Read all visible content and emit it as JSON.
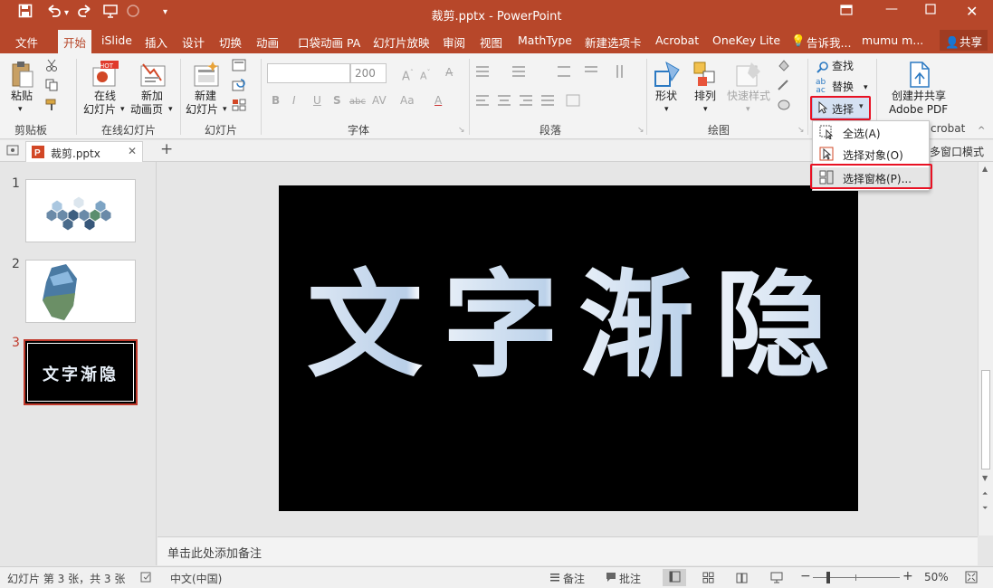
{
  "titlebar": {
    "title": "裁剪.pptx - PowerPoint",
    "icons": [
      "save-icon",
      "undo-icon",
      "redo-icon",
      "present-icon",
      "touch-mode-icon",
      "customize-qat-icon"
    ],
    "window_buttons": [
      "ribbon-display-icon",
      "minimize-icon",
      "maximize-icon",
      "close-icon"
    ]
  },
  "menu": {
    "tabs": [
      "文件",
      "开始",
      "iSlide",
      "插入",
      "设计",
      "切换",
      "动画",
      "口袋动画 PA",
      "幻灯片放映",
      "审阅",
      "视图",
      "MathType",
      "新建选项卡",
      "Acrobat",
      "OneKey Lite",
      "告诉我...",
      "mumu m..."
    ],
    "active": "开始",
    "share": "共享"
  },
  "ribbon": {
    "clipboard": {
      "paste": "粘贴",
      "label": "剪贴板"
    },
    "online_slides": {
      "online": [
        "在线",
        "幻灯片"
      ],
      "new_anim": [
        "新加",
        "动画页"
      ],
      "label": "在线幻灯片",
      "badge": "HOT"
    },
    "slides": {
      "new_slide": [
        "新建",
        "幻灯片"
      ],
      "label": "幻灯片"
    },
    "font": {
      "size": "200",
      "label": "字体",
      "buttons": [
        "B",
        "I",
        "U",
        "S",
        "abc",
        "AV",
        "Aa"
      ]
    },
    "paragraph": {
      "label": "段落"
    },
    "drawing": {
      "shape": "形状",
      "arrange": "排列",
      "quick_style": "快速样式",
      "label": "绘图"
    },
    "editing": {
      "find": "查找",
      "replace": "替换",
      "select": "选择"
    },
    "acrobat": {
      "create": [
        "创建并共享",
        "Adobe PDF"
      ],
      "label": "crobat"
    }
  },
  "dropdown": {
    "items": [
      "全选(A)",
      "选择对象(O)",
      "选择窗格(P)..."
    ]
  },
  "docbar": {
    "tab": "裁剪.pptx",
    "multiwindow": "多窗口模式"
  },
  "thumbnails": [
    {
      "num": "1"
    },
    {
      "num": "2"
    },
    {
      "num": "3",
      "text": "文字渐隐"
    }
  ],
  "slide": {
    "text": "文字渐隐"
  },
  "notes": {
    "placeholder": "单击此处添加备注"
  },
  "status": {
    "slide_info": "幻灯片 第 3 张，共 3 张",
    "language": "中文(中国)",
    "notes": "备注",
    "comments": "批注",
    "zoom": "50%"
  },
  "colors": {
    "accent": "#b7472a",
    "highlight": "#e81123",
    "selected_thumb": "#c0392b"
  }
}
